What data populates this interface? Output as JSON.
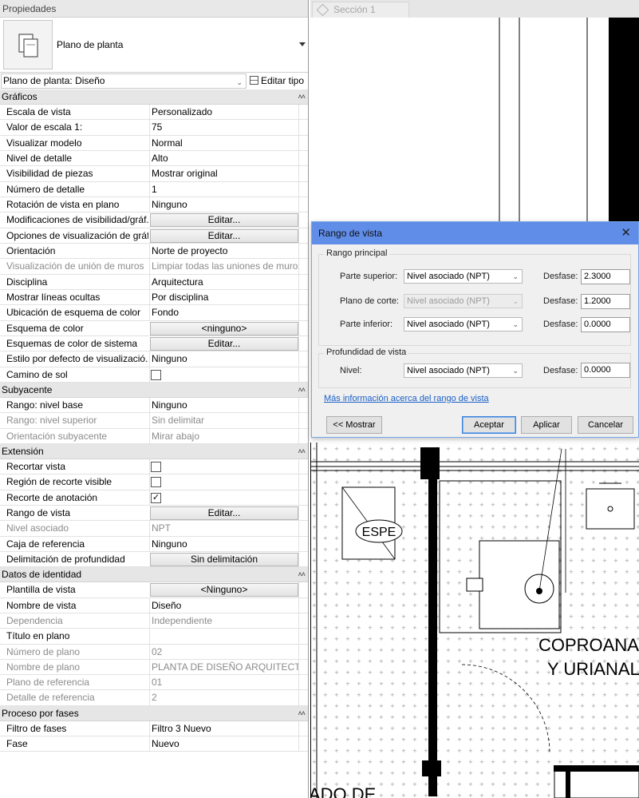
{
  "properties": {
    "title": "Propiedades",
    "type_name": "Plano de planta",
    "instance_selector": "Plano de planta: Diseño",
    "edit_type": "Editar tipo",
    "sections": [
      {
        "title": "Gráficos",
        "rows": [
          {
            "label": "Escala de vista",
            "value": "Personalizado"
          },
          {
            "label": "Valor de escala    1:",
            "value": "75"
          },
          {
            "label": "Visualizar modelo",
            "value": "Normal"
          },
          {
            "label": "Nivel de detalle",
            "value": "Alto"
          },
          {
            "label": "Visibilidad de piezas",
            "value": "Mostrar original"
          },
          {
            "label": "Número de detalle",
            "value": "1"
          },
          {
            "label": "Rotación de vista en plano",
            "value": "Ninguno"
          },
          {
            "label": "Modificaciones de visibilidad/gráf...",
            "value": "Editar...",
            "kind": "button"
          },
          {
            "label": "Opciones de visualización de gráf...",
            "value": "Editar...",
            "kind": "button"
          },
          {
            "label": "Orientación",
            "value": "Norte de proyecto"
          },
          {
            "label": "Visualización de unión de muros",
            "value": "Limpiar todas las uniones de muros",
            "disabled": true
          },
          {
            "label": "Disciplina",
            "value": "Arquitectura"
          },
          {
            "label": "Mostrar líneas ocultas",
            "value": "Por disciplina"
          },
          {
            "label": "Ubicación de esquema de color",
            "value": "Fondo"
          },
          {
            "label": "Esquema de color",
            "value": "<ninguno>",
            "kind": "button"
          },
          {
            "label": "Esquemas de color de sistema",
            "value": "Editar...",
            "kind": "button"
          },
          {
            "label": "Estilo por defecto de visualizació...",
            "value": "Ninguno"
          },
          {
            "label": "Camino de sol",
            "value": "",
            "kind": "checkbox",
            "checked": false
          }
        ]
      },
      {
        "title": "Subyacente",
        "rows": [
          {
            "label": "Rango: nivel base",
            "value": "Ninguno"
          },
          {
            "label": "Rango: nivel superior",
            "value": "Sin delimitar",
            "disabled": true
          },
          {
            "label": "Orientación subyacente",
            "value": "Mirar abajo",
            "disabled": true
          }
        ]
      },
      {
        "title": "Extensión",
        "rows": [
          {
            "label": "Recortar vista",
            "value": "",
            "kind": "checkbox",
            "checked": false
          },
          {
            "label": "Región de recorte visible",
            "value": "",
            "kind": "checkbox",
            "checked": false
          },
          {
            "label": "Recorte de anotación",
            "value": "",
            "kind": "checkbox",
            "checked": true
          },
          {
            "label": "Rango de vista",
            "value": "Editar...",
            "kind": "button"
          },
          {
            "label": "Nivel asociado",
            "value": "NPT",
            "disabled": true
          },
          {
            "label": "Caja de referencia",
            "value": "Ninguno"
          },
          {
            "label": "Delimitación de profundidad",
            "value": "Sin delimitación",
            "kind": "button"
          }
        ]
      },
      {
        "title": "Datos de identidad",
        "rows": [
          {
            "label": "Plantilla de vista",
            "value": "<Ninguno>",
            "kind": "button"
          },
          {
            "label": "Nombre de vista",
            "value": "Diseño"
          },
          {
            "label": "Dependencia",
            "value": "Independiente",
            "disabled": true
          },
          {
            "label": "Título en plano",
            "value": ""
          },
          {
            "label": "Número de plano",
            "value": "02",
            "disabled": true
          },
          {
            "label": "Nombre de plano",
            "value": "PLANTA DE DISEÑO ARQUITECTO...",
            "disabled": true
          },
          {
            "label": "Plano de referencia",
            "value": "01",
            "disabled": true
          },
          {
            "label": "Detalle de referencia",
            "value": "2",
            "disabled": true
          }
        ]
      },
      {
        "title": "Proceso por fases",
        "rows": [
          {
            "label": "Filtro de fases",
            "value": "Filtro 3 Nuevo"
          },
          {
            "label": "Fase",
            "value": "Nuevo"
          }
        ]
      }
    ]
  },
  "view": {
    "tab_label": "Sección 1",
    "drawing_labels": {
      "espe": "ESPE",
      "coproan_1": "COPROANAL",
      "coproan_2": "Y URIANAL",
      "bottom": "ADO DE"
    }
  },
  "dialog": {
    "title": "Rango de vista",
    "primary_group": "Rango principal",
    "depth_group": "Profundidad de vista",
    "offset_label": "Desfase:",
    "rows": [
      {
        "label": "Parte superior:",
        "level": "Nivel asociado (NPT)",
        "offset": "2.3000",
        "disabled": false
      },
      {
        "label": "Plano de corte:",
        "level": "Nivel asociado (NPT)",
        "offset": "1.2000",
        "disabled": true
      },
      {
        "label": "Parte inferior:",
        "level": "Nivel asociado (NPT)",
        "offset": "0.0000",
        "disabled": false
      }
    ],
    "depth_row": {
      "label": "Nivel:",
      "level": "Nivel asociado (NPT)",
      "offset": "0.0000"
    },
    "more_info_link": "Más información acerca del rango de vista",
    "buttons": {
      "show": "<< Mostrar",
      "ok": "Aceptar",
      "apply": "Aplicar",
      "cancel": "Cancelar"
    }
  }
}
